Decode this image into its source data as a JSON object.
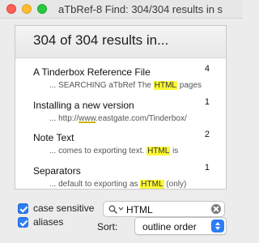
{
  "window": {
    "title": "aTbRef-8 Find: 304/304 results in s"
  },
  "results": {
    "heading": "304 of 304 results in...",
    "items": [
      {
        "title": "A Tinderbox Reference File",
        "count": "4",
        "snippet_before": "... SEARCHING aTbRef The ",
        "snippet_match": "HTML",
        "snippet_after": " pages"
      },
      {
        "title": "Installing a new version",
        "count": "1",
        "snippet_before": "... http://",
        "snippet_match": "www",
        "snippet_after": ".eastgate.com/Tinderbox/"
      },
      {
        "title": "Note Text",
        "count": "2",
        "snippet_before": "... comes to exporting text. ",
        "snippet_match": "HTML",
        "snippet_after": " is"
      },
      {
        "title": "Separators",
        "count": "1",
        "snippet_before": "... default to exporting as ",
        "snippet_match": "HTML",
        "snippet_after": " (only)"
      }
    ]
  },
  "options": {
    "case_sensitive_label": "case sensitive",
    "aliases_label": "aliases"
  },
  "search": {
    "value": "HTML"
  },
  "sort": {
    "label": "Sort:",
    "value": "outline order"
  },
  "colors": {
    "highlight": "#fbf735",
    "accent": "#2d7df6"
  }
}
